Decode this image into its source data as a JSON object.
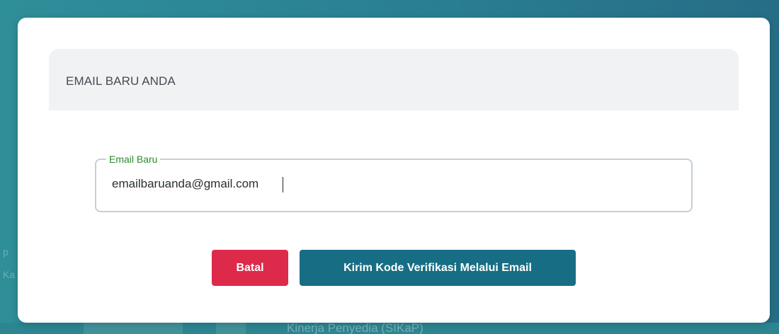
{
  "background": {
    "partial_text": "Kinerja Penyedia (SIKaP)",
    "edge_text_left": "p",
    "edge_text_left_2": "Ka"
  },
  "modal": {
    "title": "EMAIL BARU ANDA",
    "email_field": {
      "label": "Email Baru",
      "value": "emailbaruanda@gmail.com"
    },
    "buttons": {
      "cancel_label": "Batal",
      "send_label": "Kirim Kode Verifikasi Melalui Email"
    }
  },
  "colors": {
    "cancel_button": "#dd2a4b",
    "send_button": "#176e84",
    "field_label": "#2e8b2e",
    "backdrop": "#2a7f92"
  }
}
